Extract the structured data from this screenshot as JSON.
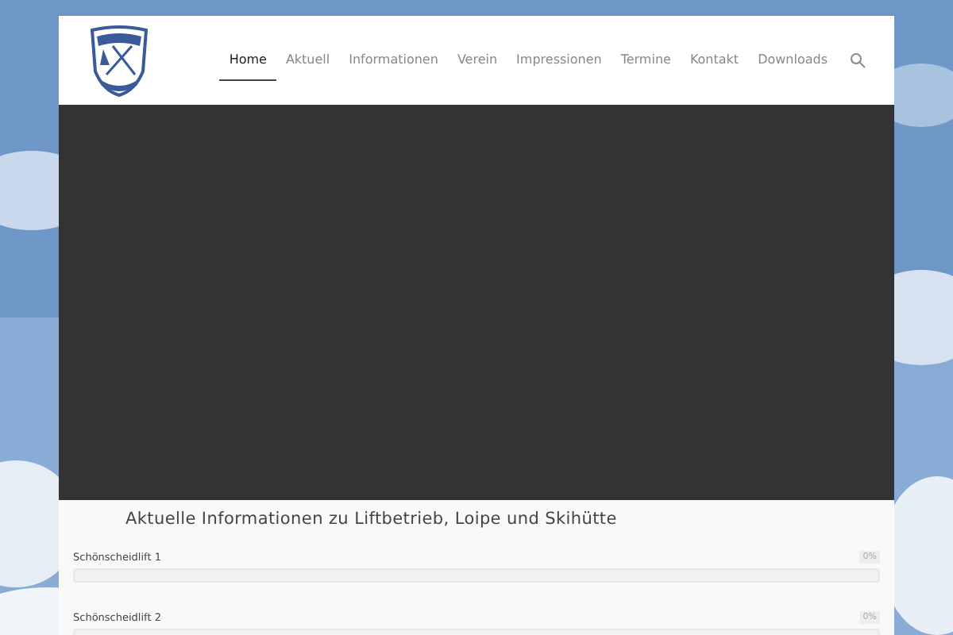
{
  "nav": {
    "items": [
      {
        "label": "Home",
        "selected": true
      },
      {
        "label": "Aktuell",
        "selected": false
      },
      {
        "label": "Informationen",
        "selected": false
      },
      {
        "label": "Verein",
        "selected": false
      },
      {
        "label": "Impressionen",
        "selected": false
      },
      {
        "label": "Termine",
        "selected": false
      },
      {
        "label": "Kontakt",
        "selected": false
      },
      {
        "label": "Downloads",
        "selected": false
      }
    ]
  },
  "hero": {
    "kind": "video"
  },
  "section": {
    "heading": "Aktuelle Informationen zu Liftbetrieb, Loipe und Skihütte",
    "lifts": [
      {
        "name": "Schönscheidlift 1",
        "reading": "0%",
        "level": 0
      },
      {
        "name": "Schönscheidlift 2",
        "reading": "0%",
        "level": 0
      }
    ]
  }
}
